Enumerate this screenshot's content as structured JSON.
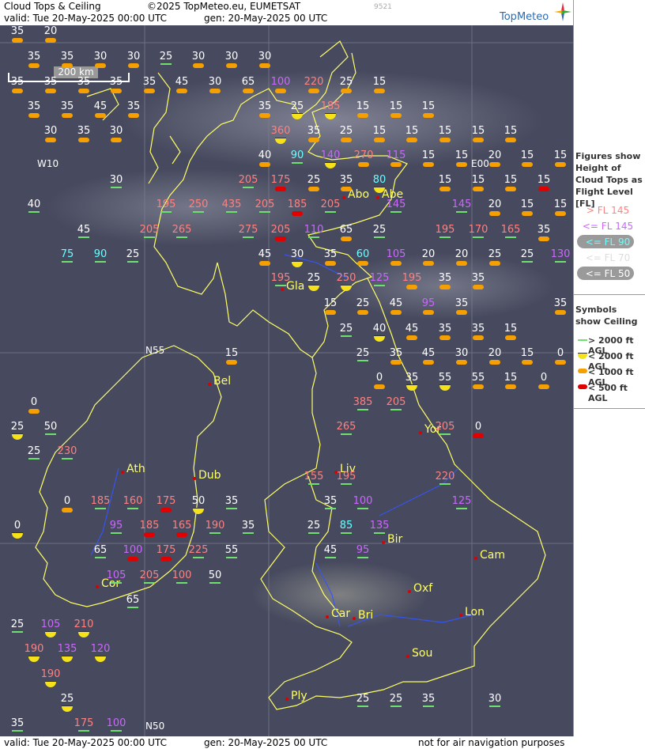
{
  "header": {
    "product": "Cloud Tops & Ceiling",
    "copyright": "©2025 TopMeteo.eu, EUMETSAT",
    "faint_code": "9521",
    "valid": "valid:   Tue   20-May-2025   00:00 UTC",
    "gen": "gen: 20-May-2025 00 UTC",
    "brand": "TopMeteo"
  },
  "footer": {
    "valid": "valid:   Tue   20-May-2025   00:00 UTC",
    "gen": "gen: 20-May-2025 00 UTC",
    "disclaimer": "not for air navigation purposes"
  },
  "scale_label": "200 km",
  "coords": {
    "w10": "W10",
    "e00": "E00",
    "n55": "N55",
    "n50": "N50"
  },
  "legend": {
    "figures_title": "Figures show Height of Cloud Tops as Flight Level  [FL]",
    "fl_items": [
      {
        "label": "> FL 145",
        "color": "#ff8080"
      },
      {
        "label": "<= FL 145",
        "color": "#cc66ff"
      },
      {
        "label": "<= FL 90",
        "color": "#66ffff"
      },
      {
        "label": "<= FL 70",
        "color": "#dddddd"
      },
      {
        "label": "<= FL 50",
        "color": "#ffffff"
      }
    ],
    "symbols_title": "Symbols show Ceiling",
    "symbol_items": [
      {
        "label": "> 2000 ft AGL",
        "type": "bar"
      },
      {
        "label": "< 2000 ft AGL",
        "type": "half"
      },
      {
        "label": "< 1000 ft AGL",
        "type": "orange"
      },
      {
        "label": "< 500 ft AGL",
        "type": "red"
      }
    ]
  },
  "colors": {
    "white": "#ffffff",
    "cyan": "#66ffff",
    "purple": "#cc66ff",
    "salmon": "#ff8080",
    "coast": "#ffff66",
    "river": "#3355ff"
  },
  "cities": [
    {
      "name": "Abo"
    },
    {
      "name": "Abe"
    },
    {
      "name": "Gla"
    },
    {
      "name": "Bel"
    },
    {
      "name": "Yor"
    },
    {
      "name": "Ath"
    },
    {
      "name": "Dub"
    },
    {
      "name": "Liv"
    },
    {
      "name": "Bir"
    },
    {
      "name": "Cam"
    },
    {
      "name": "Cor"
    },
    {
      "name": "Oxf"
    },
    {
      "name": "Car"
    },
    {
      "name": "Bri"
    },
    {
      "name": "Lon"
    },
    {
      "name": "Sou"
    },
    {
      "name": "Ply"
    }
  ],
  "fl_values": [
    {
      "v": "35",
      "c": "white",
      "s": "orange"
    },
    {
      "v": "20",
      "c": "white",
      "s": "orange"
    },
    {
      "v": "35",
      "c": "white",
      "s": "orange"
    },
    {
      "v": "35",
      "c": "white",
      "s": "orange"
    },
    {
      "v": "30",
      "c": "white",
      "s": "orange"
    },
    {
      "v": "30",
      "c": "white",
      "s": "orange"
    },
    {
      "v": "25",
      "c": "white",
      "s": "bar"
    },
    {
      "v": "30",
      "c": "white",
      "s": "orange"
    },
    {
      "v": "30",
      "c": "white",
      "s": "orange"
    },
    {
      "v": "30",
      "c": "white",
      "s": "orange"
    },
    {
      "v": "35",
      "c": "white",
      "s": "orange"
    },
    {
      "v": "35",
      "c": "white",
      "s": "orange"
    },
    {
      "v": "35",
      "c": "white",
      "s": "orange"
    },
    {
      "v": "35",
      "c": "white",
      "s": "orange"
    },
    {
      "v": "35",
      "c": "white",
      "s": "orange"
    },
    {
      "v": "45",
      "c": "white",
      "s": "orange"
    },
    {
      "v": "30",
      "c": "white",
      "s": "orange"
    },
    {
      "v": "65",
      "c": "white",
      "s": "orange"
    },
    {
      "v": "100",
      "c": "purple",
      "s": "orange"
    },
    {
      "v": "220",
      "c": "salmon",
      "s": "orange"
    },
    {
      "v": "25",
      "c": "white",
      "s": "orange"
    },
    {
      "v": "15",
      "c": "white",
      "s": "orange"
    },
    {
      "v": "35",
      "c": "white",
      "s": "orange"
    },
    {
      "v": "35",
      "c": "white",
      "s": "orange"
    },
    {
      "v": "45",
      "c": "white",
      "s": "orange"
    },
    {
      "v": "35",
      "c": "white",
      "s": "orange"
    },
    {
      "v": "35",
      "c": "white",
      "s": "orange"
    },
    {
      "v": "25",
      "c": "white",
      "s": "half"
    },
    {
      "v": "185",
      "c": "salmon",
      "s": "half"
    },
    {
      "v": "15",
      "c": "white",
      "s": "orange"
    },
    {
      "v": "15",
      "c": "white",
      "s": "orange"
    },
    {
      "v": "15",
      "c": "white",
      "s": "orange"
    },
    {
      "v": "30",
      "c": "white",
      "s": "orange"
    },
    {
      "v": "35",
      "c": "white",
      "s": "orange"
    },
    {
      "v": "30",
      "c": "white",
      "s": "orange"
    },
    {
      "v": "360",
      "c": "salmon",
      "s": "half"
    },
    {
      "v": "35",
      "c": "white",
      "s": "orange"
    },
    {
      "v": "25",
      "c": "white",
      "s": "orange"
    },
    {
      "v": "15",
      "c": "white",
      "s": "orange"
    },
    {
      "v": "15",
      "c": "white",
      "s": "orange"
    },
    {
      "v": "15",
      "c": "white",
      "s": "orange"
    },
    {
      "v": "15",
      "c": "white",
      "s": "orange"
    },
    {
      "v": "15",
      "c": "white",
      "s": "orange"
    },
    {
      "v": "40",
      "c": "white",
      "s": "orange"
    },
    {
      "v": "90",
      "c": "cyan",
      "s": "bar"
    },
    {
      "v": "140",
      "c": "purple",
      "s": "half"
    },
    {
      "v": "270",
      "c": "salmon",
      "s": "orange"
    },
    {
      "v": "115",
      "c": "purple",
      "s": "orange"
    },
    {
      "v": "15",
      "c": "white",
      "s": "orange"
    },
    {
      "v": "15",
      "c": "white",
      "s": "orange"
    },
    {
      "v": "20",
      "c": "white",
      "s": "orange"
    },
    {
      "v": "15",
      "c": "white",
      "s": "orange"
    },
    {
      "v": "15",
      "c": "white",
      "s": "orange"
    },
    {
      "v": "30",
      "c": "white",
      "s": "bar"
    },
    {
      "v": "205",
      "c": "salmon",
      "s": "bar"
    },
    {
      "v": "175",
      "c": "salmon",
      "s": "red"
    },
    {
      "v": "25",
      "c": "white",
      "s": "orange"
    },
    {
      "v": "35",
      "c": "white",
      "s": "orange"
    },
    {
      "v": "80",
      "c": "cyan",
      "s": "half"
    },
    {
      "v": "15",
      "c": "white",
      "s": "orange"
    },
    {
      "v": "15",
      "c": "white",
      "s": "orange"
    },
    {
      "v": "15",
      "c": "white",
      "s": "orange"
    },
    {
      "v": "15",
      "c": "white",
      "s": "red"
    },
    {
      "v": "40",
      "c": "white",
      "s": "bar"
    },
    {
      "v": "195",
      "c": "salmon",
      "s": "bar"
    },
    {
      "v": "250",
      "c": "salmon",
      "s": "bar"
    },
    {
      "v": "435",
      "c": "salmon",
      "s": "bar"
    },
    {
      "v": "205",
      "c": "salmon",
      "s": "bar"
    },
    {
      "v": "185",
      "c": "salmon",
      "s": "red"
    },
    {
      "v": "205",
      "c": "salmon",
      "s": "bar"
    },
    {
      "v": "145",
      "c": "purple",
      "s": "bar"
    },
    {
      "v": "145",
      "c": "purple",
      "s": "bar"
    },
    {
      "v": "20",
      "c": "white",
      "s": "orange"
    },
    {
      "v": "15",
      "c": "white",
      "s": "orange"
    },
    {
      "v": "15",
      "c": "white",
      "s": "orange"
    },
    {
      "v": "45",
      "c": "white",
      "s": "bar"
    },
    {
      "v": "205",
      "c": "salmon",
      "s": "bar"
    },
    {
      "v": "265",
      "c": "salmon",
      "s": "bar"
    },
    {
      "v": "275",
      "c": "salmon",
      "s": "bar"
    },
    {
      "v": "205",
      "c": "salmon",
      "s": "red"
    },
    {
      "v": "110",
      "c": "purple",
      "s": "bar"
    },
    {
      "v": "65",
      "c": "white",
      "s": "orange"
    },
    {
      "v": "25",
      "c": "white",
      "s": "bar"
    },
    {
      "v": "195",
      "c": "salmon",
      "s": "bar"
    },
    {
      "v": "170",
      "c": "salmon",
      "s": "bar"
    },
    {
      "v": "165",
      "c": "salmon",
      "s": "bar"
    },
    {
      "v": "35",
      "c": "white",
      "s": "orange"
    },
    {
      "v": "75",
      "c": "cyan",
      "s": "bar"
    },
    {
      "v": "90",
      "c": "cyan",
      "s": "bar"
    },
    {
      "v": "25",
      "c": "white",
      "s": "bar"
    },
    {
      "v": "45",
      "c": "white",
      "s": "orange"
    },
    {
      "v": "30",
      "c": "white",
      "s": "half"
    },
    {
      "v": "35",
      "c": "white",
      "s": "orange"
    },
    {
      "v": "60",
      "c": "cyan",
      "s": "orange"
    },
    {
      "v": "105",
      "c": "purple",
      "s": "orange"
    },
    {
      "v": "20",
      "c": "white",
      "s": "orange"
    },
    {
      "v": "20",
      "c": "white",
      "s": "orange"
    },
    {
      "v": "25",
      "c": "white",
      "s": "orange"
    },
    {
      "v": "25",
      "c": "white",
      "s": "bar"
    },
    {
      "v": "130",
      "c": "purple",
      "s": "bar"
    },
    {
      "v": "195",
      "c": "salmon",
      "s": "bar"
    },
    {
      "v": "25",
      "c": "white",
      "s": "half"
    },
    {
      "v": "250",
      "c": "salmon",
      "s": "half"
    },
    {
      "v": "125",
      "c": "purple",
      "s": "bar"
    },
    {
      "v": "195",
      "c": "salmon",
      "s": "orange"
    },
    {
      "v": "35",
      "c": "white",
      "s": "orange"
    },
    {
      "v": "35",
      "c": "white",
      "s": "orange"
    },
    {
      "v": "15",
      "c": "white",
      "s": "orange"
    },
    {
      "v": "25",
      "c": "white",
      "s": "orange"
    },
    {
      "v": "45",
      "c": "white",
      "s": "orange"
    },
    {
      "v": "95",
      "c": "purple",
      "s": "orange"
    },
    {
      "v": "35",
      "c": "white",
      "s": "orange"
    },
    {
      "v": "35",
      "c": "white",
      "s": "orange"
    },
    {
      "v": "25",
      "c": "white",
      "s": "bar"
    },
    {
      "v": "40",
      "c": "white",
      "s": "half"
    },
    {
      "v": "45",
      "c": "white",
      "s": "orange"
    },
    {
      "v": "35",
      "c": "white",
      "s": "orange"
    },
    {
      "v": "35",
      "c": "white",
      "s": "orange"
    },
    {
      "v": "15",
      "c": "white",
      "s": "orange"
    },
    {
      "v": "15",
      "c": "white",
      "s": "orange"
    },
    {
      "v": "25",
      "c": "white",
      "s": "bar"
    },
    {
      "v": "35",
      "c": "white",
      "s": "orange"
    },
    {
      "v": "45",
      "c": "white",
      "s": "orange"
    },
    {
      "v": "30",
      "c": "white",
      "s": "orange"
    },
    {
      "v": "20",
      "c": "white",
      "s": "orange"
    },
    {
      "v": "15",
      "c": "white",
      "s": "orange"
    },
    {
      "v": "0",
      "c": "white",
      "s": "orange"
    },
    {
      "v": "0",
      "c": "white",
      "s": "orange"
    },
    {
      "v": "35",
      "c": "white",
      "s": "half"
    },
    {
      "v": "55",
      "c": "white",
      "s": "half"
    },
    {
      "v": "55",
      "c": "white",
      "s": "orange"
    },
    {
      "v": "15",
      "c": "white",
      "s": "orange"
    },
    {
      "v": "0",
      "c": "white",
      "s": "orange"
    },
    {
      "v": "0",
      "c": "white",
      "s": "orange"
    },
    {
      "v": "385",
      "c": "salmon",
      "s": "bar"
    },
    {
      "v": "205",
      "c": "salmon",
      "s": "bar"
    },
    {
      "v": "25",
      "c": "white",
      "s": "half"
    },
    {
      "v": "50",
      "c": "white",
      "s": "bar"
    },
    {
      "v": "265",
      "c": "salmon",
      "s": "bar"
    },
    {
      "v": "205",
      "c": "salmon",
      "s": "bar"
    },
    {
      "v": "0",
      "c": "white",
      "s": "red"
    },
    {
      "v": "25",
      "c": "white",
      "s": "bar"
    },
    {
      "v": "230",
      "c": "salmon",
      "s": "bar"
    },
    {
      "v": "155",
      "c": "salmon",
      "s": "bar"
    },
    {
      "v": "195",
      "c": "salmon",
      "s": "bar"
    },
    {
      "v": "220",
      "c": "salmon",
      "s": "bar"
    },
    {
      "v": "0",
      "c": "white",
      "s": "orange"
    },
    {
      "v": "185",
      "c": "salmon",
      "s": "bar"
    },
    {
      "v": "160",
      "c": "salmon",
      "s": "bar"
    },
    {
      "v": "175",
      "c": "salmon",
      "s": "red"
    },
    {
      "v": "50",
      "c": "white",
      "s": "half"
    },
    {
      "v": "35",
      "c": "white",
      "s": "bar"
    },
    {
      "v": "35",
      "c": "white",
      "s": "bar"
    },
    {
      "v": "100",
      "c": "purple",
      "s": "bar"
    },
    {
      "v": "125",
      "c": "purple",
      "s": "bar"
    },
    {
      "v": "0",
      "c": "white",
      "s": "half"
    },
    {
      "v": "95",
      "c": "purple",
      "s": "bar"
    },
    {
      "v": "185",
      "c": "salmon",
      "s": "red"
    },
    {
      "v": "165",
      "c": "salmon",
      "s": "red"
    },
    {
      "v": "190",
      "c": "salmon",
      "s": "bar"
    },
    {
      "v": "35",
      "c": "white",
      "s": "bar"
    },
    {
      "v": "25",
      "c": "white",
      "s": "bar"
    },
    {
      "v": "85",
      "c": "cyan",
      "s": "bar"
    },
    {
      "v": "135",
      "c": "purple",
      "s": "bar"
    },
    {
      "v": "65",
      "c": "white",
      "s": "bar"
    },
    {
      "v": "100",
      "c": "purple",
      "s": "red"
    },
    {
      "v": "175",
      "c": "salmon",
      "s": "red"
    },
    {
      "v": "225",
      "c": "salmon",
      "s": "bar"
    },
    {
      "v": "55",
      "c": "white",
      "s": "bar"
    },
    {
      "v": "45",
      "c": "white",
      "s": "bar"
    },
    {
      "v": "95",
      "c": "purple",
      "s": "bar"
    },
    {
      "v": "105",
      "c": "purple",
      "s": "bar"
    },
    {
      "v": "205",
      "c": "salmon",
      "s": "bar"
    },
    {
      "v": "100",
      "c": "salmon",
      "s": "bar"
    },
    {
      "v": "50",
      "c": "white",
      "s": "bar"
    },
    {
      "v": "65",
      "c": "white",
      "s": "bar"
    },
    {
      "v": "25",
      "c": "white",
      "s": "bar"
    },
    {
      "v": "105",
      "c": "purple",
      "s": "half"
    },
    {
      "v": "210",
      "c": "salmon",
      "s": "half"
    },
    {
      "v": "190",
      "c": "salmon",
      "s": "half"
    },
    {
      "v": "135",
      "c": "purple",
      "s": "half"
    },
    {
      "v": "120",
      "c": "purple",
      "s": "half"
    },
    {
      "v": "190",
      "c": "salmon",
      "s": "half"
    },
    {
      "v": "25",
      "c": "white",
      "s": "half"
    },
    {
      "v": "25",
      "c": "white",
      "s": "bar"
    },
    {
      "v": "25",
      "c": "white",
      "s": "bar"
    },
    {
      "v": "35",
      "c": "white",
      "s": "bar"
    },
    {
      "v": "30",
      "c": "white",
      "s": "bar"
    },
    {
      "v": "35",
      "c": "white",
      "s": "bar"
    },
    {
      "v": "175",
      "c": "salmon",
      "s": "bar"
    },
    {
      "v": "100",
      "c": "purple",
      "s": "bar"
    },
    {
      "v": "25",
      "c": "white",
      "s": "bar"
    }
  ]
}
